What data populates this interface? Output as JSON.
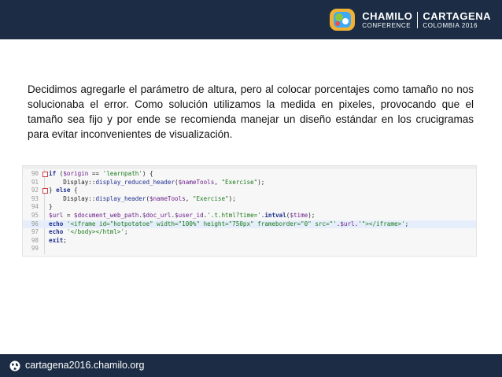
{
  "header": {
    "logo_big_left": "CHAMILO",
    "logo_small_left": "CONFERENCE",
    "logo_big_right": "CARTAGENA",
    "logo_small_right": "COLOMBIA 2016",
    "background": "#1b2c44",
    "logo_colors": [
      "#f2b134",
      "#3fa9f5",
      "#8cc63f",
      "#e84e4e"
    ]
  },
  "content": {
    "paragraph": "Decidimos agregarle el parámetro de altura, pero al colocar porcentajes como tamaño no nos solucionaba el error. Como solución utilizamos la medida en pixeles, provocando que el tamaño sea fijo y por ende se recomienda manejar un diseño estándar en los crucigramas para evitar inconvenientes de visualización."
  },
  "code": {
    "highlighted_line": 96,
    "lines": [
      {
        "num": "90",
        "segments": [
          [
            "kw",
            "if"
          ],
          [
            "cls",
            " ("
          ],
          [
            "var",
            "$origin"
          ],
          [
            "cls",
            " == "
          ],
          [
            "str",
            "'learnpath'"
          ],
          [
            "cls",
            ") {"
          ]
        ]
      },
      {
        "num": "91",
        "segments": [
          [
            "cls",
            "    Display::"
          ],
          [
            "fn",
            "display_reduced_header"
          ],
          [
            "cls",
            "("
          ],
          [
            "var",
            "$nameTools"
          ],
          [
            "cls",
            ", "
          ],
          [
            "str",
            "\"Exercise\""
          ],
          [
            "cls",
            ");"
          ]
        ]
      },
      {
        "num": "92",
        "segments": [
          [
            "cls",
            "} "
          ],
          [
            "kw",
            "else"
          ],
          [
            "cls",
            " {"
          ]
        ]
      },
      {
        "num": "93",
        "segments": [
          [
            "cls",
            "    Display::"
          ],
          [
            "fn",
            "display_header"
          ],
          [
            "cls",
            "("
          ],
          [
            "var",
            "$nameTools"
          ],
          [
            "cls",
            ", "
          ],
          [
            "str",
            "\"Exercise\""
          ],
          [
            "cls",
            ");"
          ]
        ]
      },
      {
        "num": "94",
        "segments": [
          [
            "cls",
            "}"
          ]
        ]
      },
      {
        "num": "95",
        "segments": [
          [
            "var",
            "$url"
          ],
          [
            "cls",
            " = "
          ],
          [
            "var",
            "$document_web_path"
          ],
          [
            "cls",
            "."
          ],
          [
            "var",
            "$doc_url"
          ],
          [
            "cls",
            "."
          ],
          [
            "var",
            "$user_id"
          ],
          [
            "cls",
            "."
          ],
          [
            "str",
            "'.t.html?time='"
          ],
          [
            "cls",
            "."
          ],
          [
            "kw",
            "intval"
          ],
          [
            "cls",
            "("
          ],
          [
            "var",
            "$time"
          ],
          [
            "cls",
            ");"
          ]
        ]
      },
      {
        "num": "96",
        "segments": [
          [
            "kw",
            "echo"
          ],
          [
            "cls",
            " "
          ],
          [
            "str",
            "'<iframe id=\"hotpotatoe\" width=\"100%\" height=\"750px\" frameborder=\"0\" src=\"'"
          ],
          [
            "cls",
            "."
          ],
          [
            "var",
            "$url"
          ],
          [
            "cls",
            "."
          ],
          [
            "str",
            "'\"></iframe>'"
          ],
          [
            "cls",
            ";"
          ]
        ]
      },
      {
        "num": "97",
        "segments": [
          [
            "kw",
            "echo"
          ],
          [
            "cls",
            " "
          ],
          [
            "str",
            "'</body></html>'"
          ],
          [
            "cls",
            ";"
          ]
        ]
      },
      {
        "num": "98",
        "segments": [
          [
            "kw",
            "exit"
          ],
          [
            "cls",
            ";"
          ]
        ]
      },
      {
        "num": "99",
        "segments": []
      }
    ]
  },
  "footer": {
    "url": "cartagena2016.chamilo.org"
  }
}
